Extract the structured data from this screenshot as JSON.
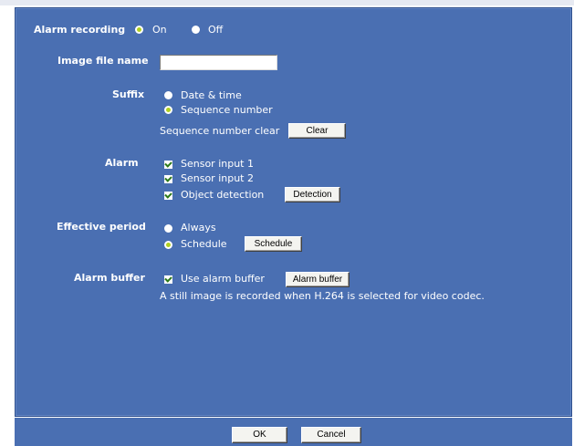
{
  "alarm_recording": {
    "label": "Alarm recording",
    "on_label": "On",
    "off_label": "Off"
  },
  "image_file_name": {
    "label": "Image file name",
    "value": ""
  },
  "suffix": {
    "label": "Suffix",
    "options": [
      "Date & time",
      "Sequence number"
    ],
    "clear_label": "Sequence number clear",
    "clear_button": "Clear"
  },
  "alarm": {
    "label": "Alarm",
    "items": [
      "Sensor input 1",
      "Sensor input 2",
      "Object detection"
    ],
    "detection_button": "Detection"
  },
  "effective_period": {
    "label": "Effective period",
    "options": [
      "Always",
      "Schedule"
    ],
    "schedule_button": "Schedule"
  },
  "alarm_buffer": {
    "label": "Alarm buffer",
    "checkbox_label": "Use alarm buffer",
    "button": "Alarm buffer",
    "note": "A still image is recorded when H.264 is selected for video codec."
  },
  "footer": {
    "ok": "OK",
    "cancel": "Cancel"
  },
  "colors": {
    "panel": "#4a6fb2",
    "selected_radio": "#b0d020"
  }
}
